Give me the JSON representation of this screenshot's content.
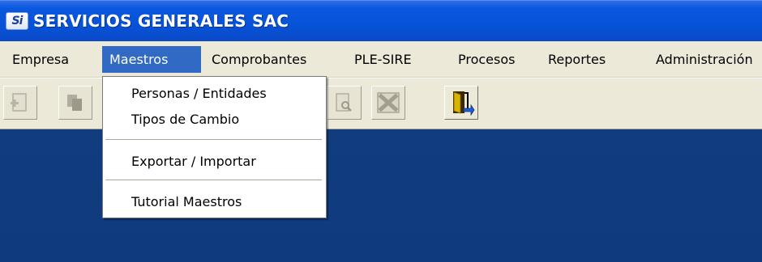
{
  "window": {
    "logo_text": "Si",
    "title": "SERVICIOS GENERALES SAC"
  },
  "menubar": {
    "items": [
      {
        "label": "Empresa",
        "active": false
      },
      {
        "label": "Maestros",
        "active": true
      },
      {
        "label": "Comprobantes",
        "active": false
      },
      {
        "label": "PLE-SIRE",
        "active": false
      },
      {
        "label": "Procesos",
        "active": false
      },
      {
        "label": "Reportes",
        "active": false
      },
      {
        "label": "Administración",
        "active": false
      }
    ]
  },
  "toolbar": {
    "buttons": [
      {
        "icon": "add-document-icon",
        "enabled": false
      },
      {
        "icon": "copy-documents-icon",
        "enabled": false
      },
      {
        "icon": "print-preview-icon",
        "enabled": false
      },
      {
        "icon": "excel-icon",
        "enabled": false
      },
      {
        "icon": "exit-door-icon",
        "enabled": true
      }
    ]
  },
  "dropdown": {
    "items": [
      {
        "label": "Personas / Entidades"
      },
      {
        "label": "Tipos de Cambio"
      },
      {
        "label": "Exportar / Importar"
      },
      {
        "label": "Tutorial Maestros"
      }
    ]
  },
  "colors": {
    "titlebar": "#0653d8",
    "menu_highlight": "#316ac5",
    "desktop": "#0f3a7e",
    "chrome": "#ece9d8"
  }
}
